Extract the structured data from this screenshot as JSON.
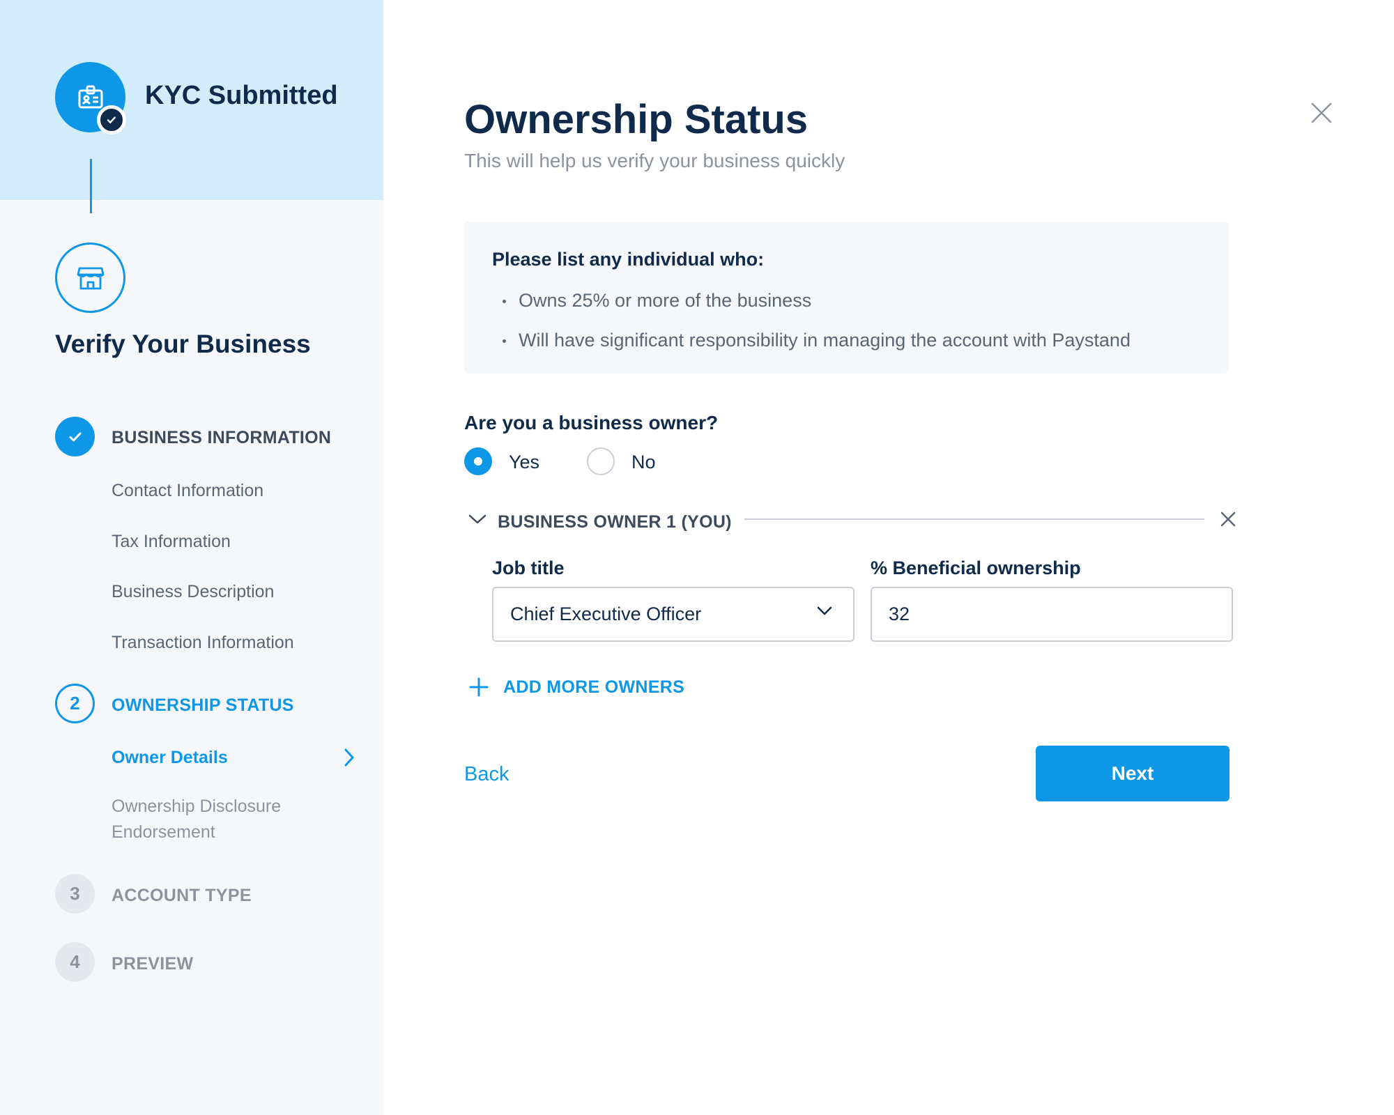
{
  "sidebar": {
    "kyc_title": "KYC Submitted",
    "verify_title": "Verify Your Business",
    "steps": [
      {
        "number": "",
        "label": "BUSINESS INFORMATION",
        "state": "done",
        "sub_items": [
          "Contact Information",
          "Tax Information",
          "Business Description",
          "Transaction Information"
        ]
      },
      {
        "number": "2",
        "label": "OWNERSHIP STATUS",
        "state": "active",
        "sub_items": [
          "Owner Details",
          "Ownership Disclosure",
          "Endorsement"
        ]
      },
      {
        "number": "3",
        "label": "ACCOUNT TYPE",
        "state": "idle"
      },
      {
        "number": "4",
        "label": "PREVIEW",
        "state": "idle"
      }
    ]
  },
  "main": {
    "title": "Ownership Status",
    "subtitle": "This will help us verify your business quickly",
    "info": {
      "heading": "Please list any individual who:",
      "bullets": [
        "Owns 25% or more of the business",
        "Will have significant responsibility in managing the account with Paystand"
      ]
    },
    "question": "Are you a business owner?",
    "options": {
      "yes": "Yes",
      "no": "No",
      "selected": "yes"
    },
    "owner": {
      "title": "BUSINESS OWNER 1 (YOU)",
      "job_title_label": "Job title",
      "job_title_value": "Chief Executive Officer",
      "ownership_label": "% Beneficial ownership",
      "ownership_value": "32"
    },
    "add_owners": "ADD MORE OWNERS",
    "back": "Back",
    "next": "Next"
  },
  "colors": {
    "accent": "#0d97e6",
    "navy": "#0f2a4a",
    "sidebar_bg": "#f5f7fb",
    "kyc_band": "#d3ecfa",
    "muted": "#8d939e"
  }
}
